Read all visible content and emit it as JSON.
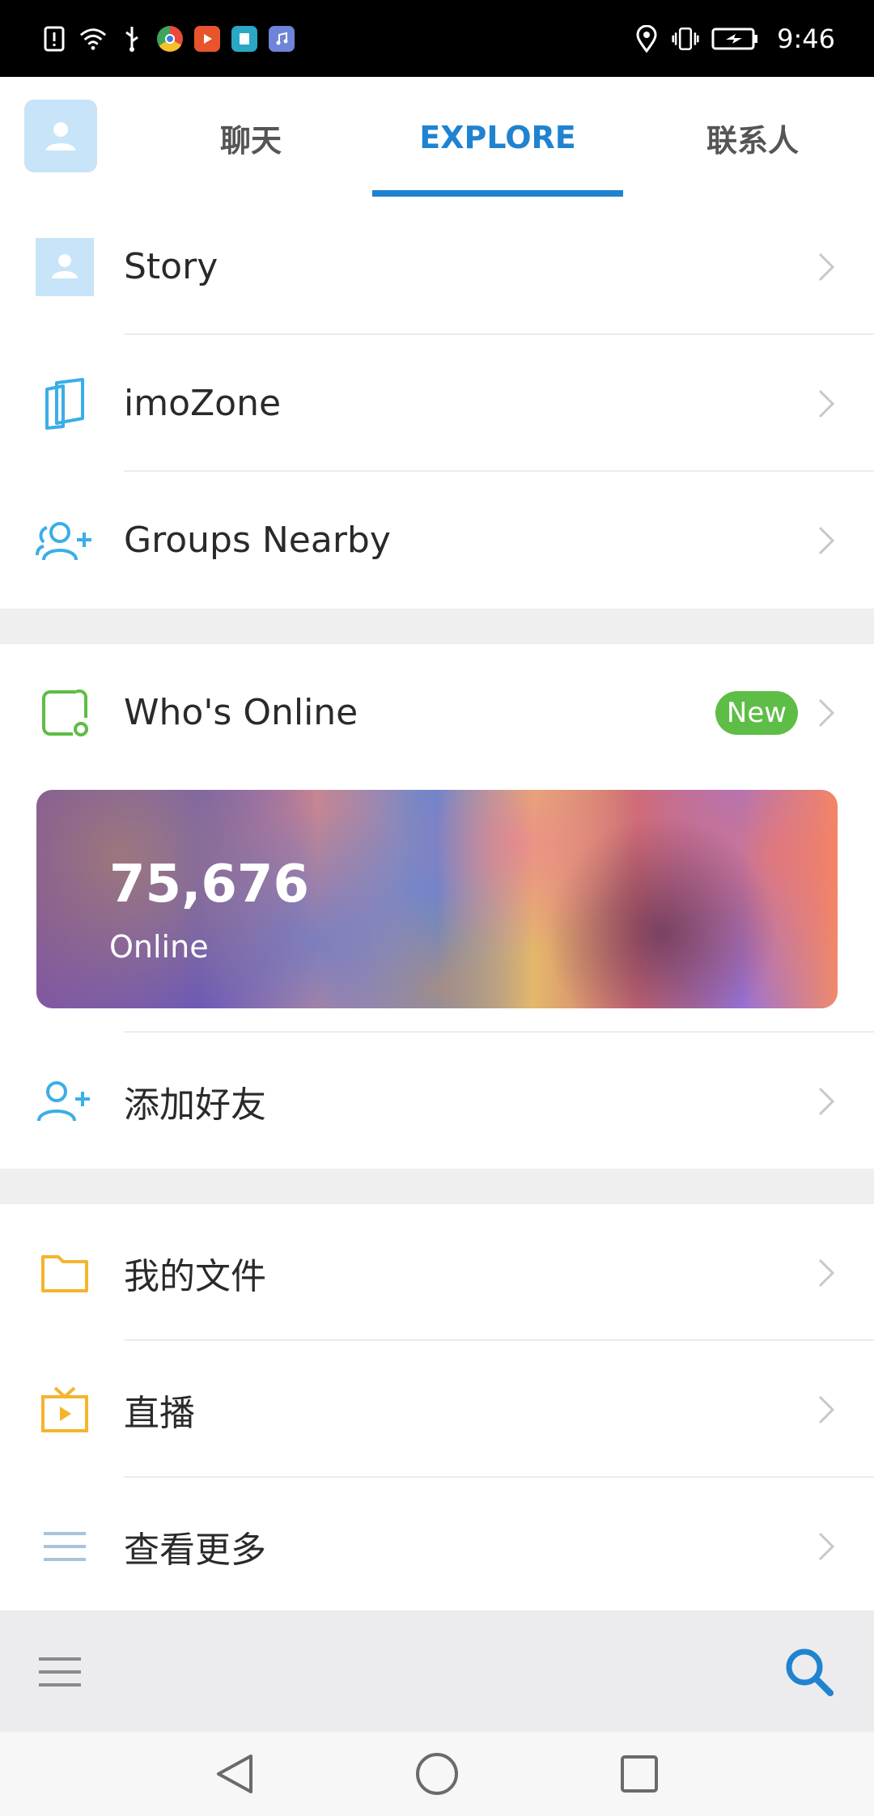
{
  "status_bar": {
    "time": "9:46",
    "colors": {
      "app1": "#e94a3a",
      "app2": "#e8542b",
      "app3": "#2aa7c4",
      "app4": "#6f83d8"
    }
  },
  "tabs": [
    {
      "label": "聊天",
      "active": false
    },
    {
      "label": "EXPLORE",
      "active": true
    },
    {
      "label": "联系人",
      "active": false
    }
  ],
  "section1": [
    {
      "label": "Story",
      "icon": "person-icon"
    },
    {
      "label": "imoZone",
      "icon": "imozone-icon"
    },
    {
      "label": "Groups Nearby",
      "icon": "group-add-icon"
    }
  ],
  "whos_online": {
    "label": "Who's Online",
    "badge": "New",
    "count": "75,676",
    "count_label": "Online"
  },
  "add_friend": {
    "label": "添加好友"
  },
  "section3": [
    {
      "label": "我的文件",
      "icon": "folder-icon"
    },
    {
      "label": "直播",
      "icon": "tv-icon"
    },
    {
      "label": "查看更多",
      "icon": "more-lines-icon"
    }
  ],
  "colors": {
    "accent": "#1f83d0",
    "icon_blue": "#3aaee8",
    "icon_green": "#5ebd46",
    "icon_yellow": "#f4b52d"
  }
}
